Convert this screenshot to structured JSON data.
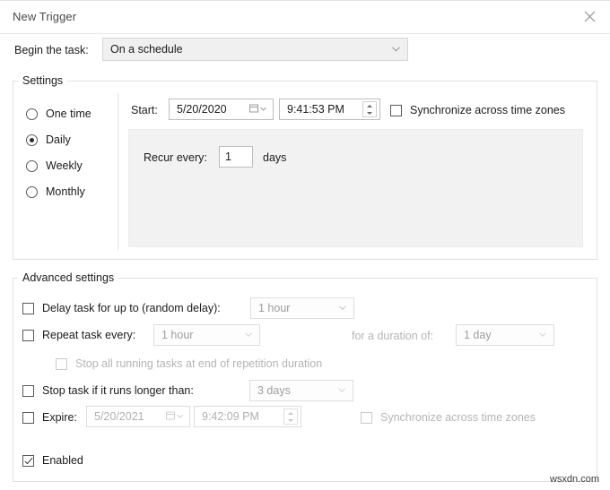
{
  "window": {
    "title": "New Trigger",
    "close_icon": "close-icon"
  },
  "begin": {
    "label": "Begin the task:",
    "value": "On a schedule",
    "arrow_icon": "chevron-down-icon"
  },
  "settings": {
    "group_label": "Settings",
    "schedule_options": [
      {
        "label": "One time",
        "selected": false
      },
      {
        "label": "Daily",
        "selected": true
      },
      {
        "label": "Weekly",
        "selected": false
      },
      {
        "label": "Monthly",
        "selected": false
      }
    ],
    "start_label": "Start:",
    "start_date": "5/20/2020",
    "start_time": "9:41:53 PM",
    "calendar_icon": "calendar-icon",
    "spinner_icon": "updown-spinner-icon",
    "sync_label": "Synchronize across time zones",
    "sync_checked": false,
    "recur_label": "Recur every:",
    "recur_value": "1",
    "recur_unit": "days"
  },
  "advanced": {
    "group_label": "Advanced settings",
    "delay_label": "Delay task for up to (random delay):",
    "delay_value": "1 hour",
    "delay_checked": false,
    "repeat_label": "Repeat task every:",
    "repeat_value": "1 hour",
    "repeat_checked": false,
    "duration_label": "for a duration of:",
    "duration_value": "1 day",
    "stop_all_label": "Stop all running tasks at end of repetition duration",
    "stop_all_checked": false,
    "stop_task_label": "Stop task if it runs longer than:",
    "stop_task_value": "3 days",
    "stop_task_checked": false,
    "expire_label": "Expire:",
    "expire_date": "5/20/2021",
    "expire_time": "9:42:09 PM",
    "expire_checked": false,
    "expire_sync_label": "Synchronize across time zones",
    "expire_sync_checked": false,
    "enabled_label": "Enabled",
    "enabled_checked": true
  },
  "watermark": "wsxdn.com"
}
